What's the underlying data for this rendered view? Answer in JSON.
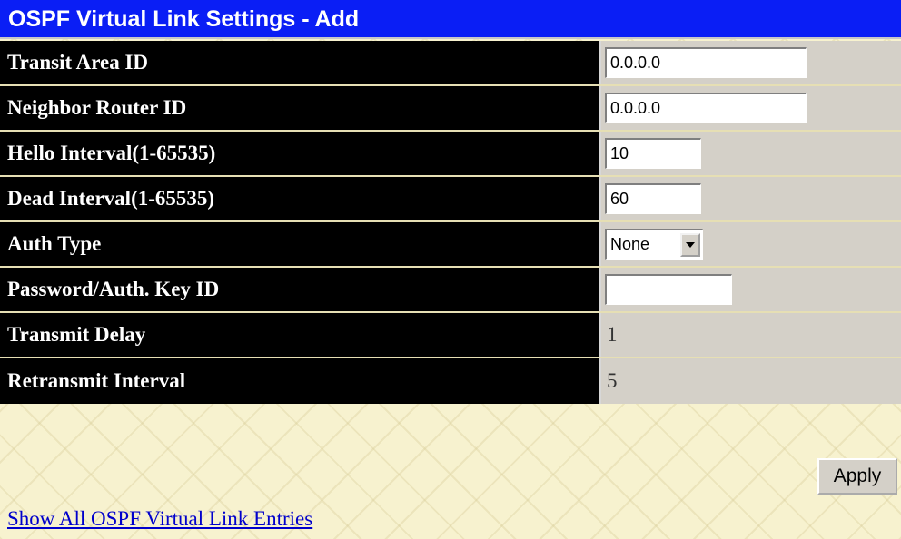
{
  "title": "OSPF Virtual Link Settings - Add",
  "fields": {
    "transit_area_id": {
      "label": "Transit Area ID",
      "value": "0.0.0.0"
    },
    "neighbor_router_id": {
      "label": "Neighbor Router ID",
      "value": "0.0.0.0"
    },
    "hello_interval": {
      "label": "Hello Interval(1-65535)",
      "value": "10"
    },
    "dead_interval": {
      "label": "Dead Interval(1-65535)",
      "value": "60"
    },
    "auth_type": {
      "label": "Auth Type",
      "selected": "None"
    },
    "password_key": {
      "label": "Password/Auth. Key ID",
      "value": ""
    },
    "transmit_delay": {
      "label": "Transmit Delay",
      "value": "1"
    },
    "retransmit_interval": {
      "label": "Retransmit Interval",
      "value": "5"
    }
  },
  "apply_label": "Apply",
  "link_text": "Show All OSPF Virtual Link Entries",
  "colors": {
    "title_bg": "#0a1ef5",
    "label_bg": "#000000",
    "value_bg": "#d4d0c8",
    "page_bg": "#f7f2cf",
    "link": "#0000cc"
  },
  "icons": {
    "auth_type_dropdown": "chevron-down-icon"
  }
}
